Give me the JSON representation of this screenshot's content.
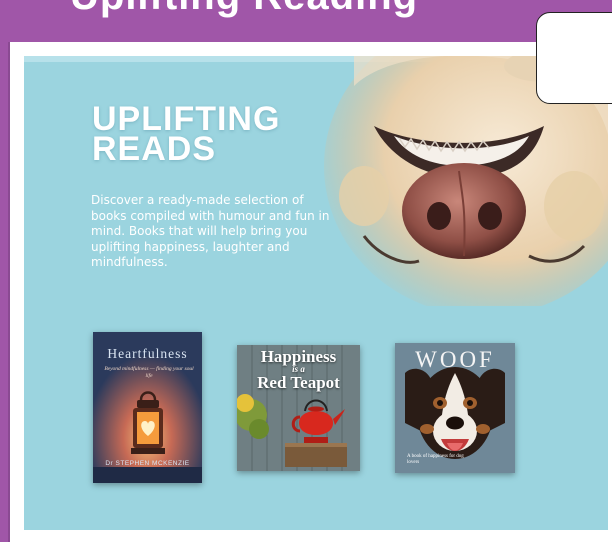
{
  "page": {
    "top_heading": "Uplifting Reading",
    "headline_lines": [
      "UPLIFTING",
      "READS"
    ],
    "description": "Discover a ready-made selection of books compiled with humour and fun in mind. Books that will help bring you uplifting happiness, laughter and mindfulness."
  },
  "books": [
    {
      "title": "Heartfulness",
      "subtitle": "Beyond mindfulness — finding your soul life",
      "author": "Dr STEPHEN MCKENZIE",
      "cover_art": "lantern-with-heart-icon"
    },
    {
      "title_small": "Happiness",
      "title_connector": "is a",
      "title_big": "Red Teapot",
      "cover_art": "red-teapot-icon"
    },
    {
      "title": "WOOF",
      "subtitle": "A book of happiness for dog lovers",
      "cover_art": "dog-face-icon"
    }
  ],
  "colors": {
    "page_background": "#a056a8",
    "banner_background": "#9bd4df",
    "text_light": "#ffffff"
  }
}
